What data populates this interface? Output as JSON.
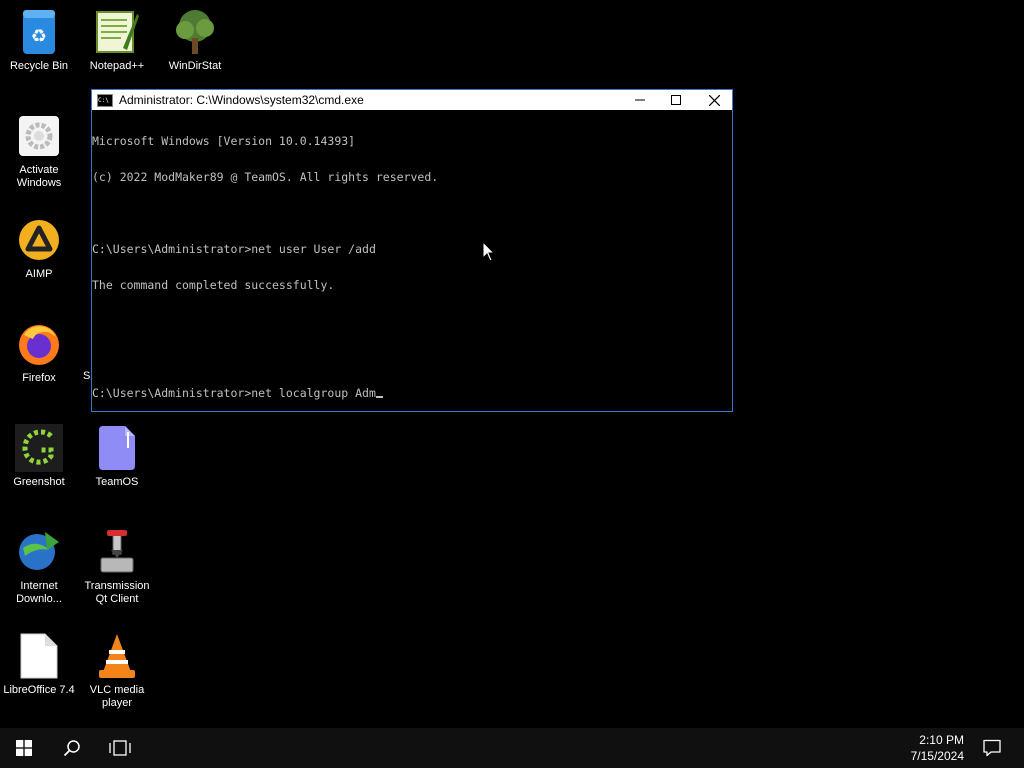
{
  "desktop": {
    "icons": [
      {
        "label": "Recycle Bin",
        "icon": "recycle-bin-icon"
      },
      {
        "label": "Notepad++",
        "icon": "notepad-plus-plus-icon"
      },
      {
        "label": "WinDirStat",
        "icon": "windirstat-icon"
      },
      {
        "label": "Activate Windows",
        "icon": "activate-windows-icon"
      },
      {
        "label": "AIMP",
        "icon": "aimp-icon"
      },
      {
        "label": "Firefox",
        "icon": "firefox-icon"
      },
      {
        "label": "Greenshot",
        "icon": "greenshot-icon"
      },
      {
        "label": "TeamOS",
        "icon": "teamos-icon"
      },
      {
        "label": "Internet Downlo...",
        "icon": "internet-download-manager-icon"
      },
      {
        "label": "Transmission Qt Client",
        "icon": "transmission-icon"
      },
      {
        "label": "LibreOffice 7.4",
        "icon": "libreoffice-icon"
      },
      {
        "label": "VLC media player",
        "icon": "vlc-icon"
      }
    ],
    "partial_label": "S"
  },
  "cmd_window": {
    "title": "Administrator: C:\\Windows\\system32\\cmd.exe",
    "icon_text": "C:\\",
    "lines": [
      "Microsoft Windows [Version 10.0.14393]",
      "(c) 2022 ModMaker89 @ TeamOS. All rights reserved.",
      "",
      "C:\\Users\\Administrator>net user User /add",
      "The command completed successfully.",
      "",
      "",
      "C:\\Users\\Administrator>net localgroup Adm"
    ]
  },
  "taskbar": {
    "time": "2:10 PM",
    "date": "7/15/2024"
  },
  "colors": {
    "desktop_bg": "#000000",
    "taskbar_bg": "#101010",
    "window_border": "#3a78c9",
    "console_text": "#c0c0c0"
  }
}
